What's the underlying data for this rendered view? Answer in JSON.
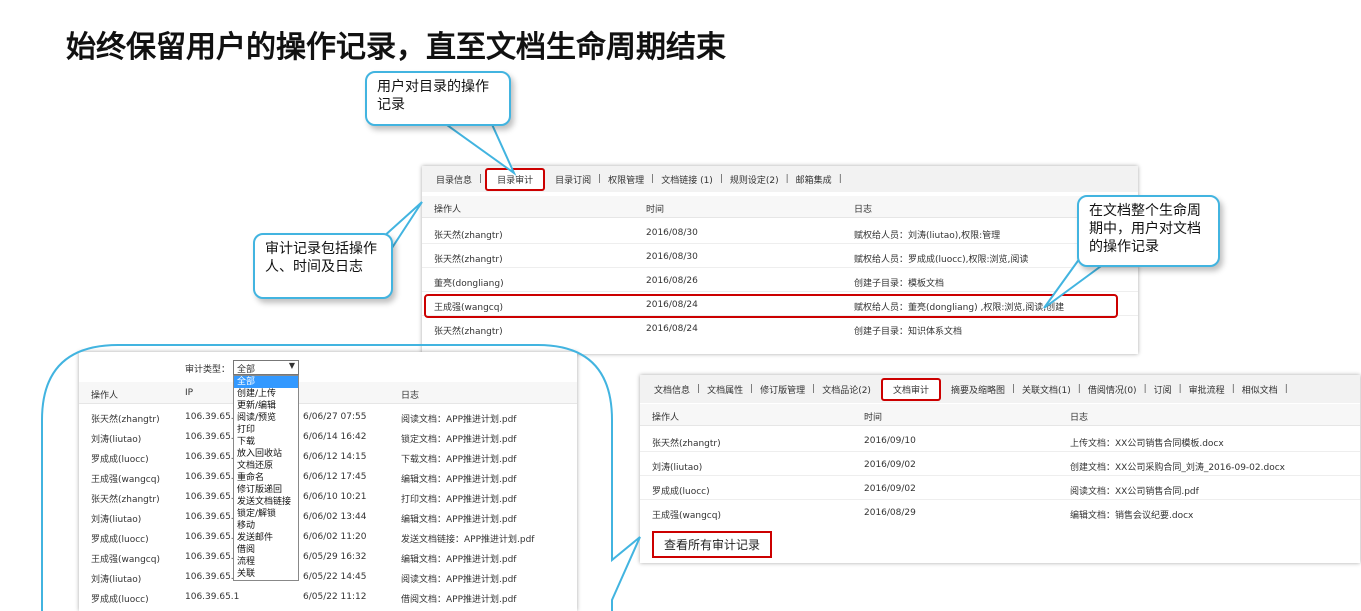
{
  "title": "始终保留用户的操作记录，直至文档生命周期结束",
  "callouts": {
    "dir_ops": "用户对目录的操作记录",
    "audit_fields": "审计记录包括操作人、时间及日志",
    "lifecycle": "在文档整个生命周期中，用户对文档的操作记录"
  },
  "dir_panel": {
    "tabs": [
      {
        "label": "目录信息",
        "active": false
      },
      {
        "label": "目录审计",
        "active": true
      },
      {
        "label": "目录订阅",
        "active": false
      },
      {
        "label": "权限管理",
        "active": false
      },
      {
        "label": "文档链接 (1)",
        "active": false
      },
      {
        "label": "规则设定(2)",
        "active": false
      },
      {
        "label": "邮箱集成",
        "active": false
      }
    ],
    "columns": [
      "操作人",
      "时间",
      "日志"
    ],
    "rows": [
      {
        "user": "张天然(zhangtr)",
        "time": "2016/08/30",
        "log": "赋权给人员：刘涛(liutao),权限:管理"
      },
      {
        "user": "张天然(zhangtr)",
        "time": "2016/08/30",
        "log": "赋权给人员：罗成成(luocc),权限:浏览,阅读"
      },
      {
        "user": "董亮(dongliang)",
        "time": "2016/08/26",
        "log": "创建子目录：模板文档"
      },
      {
        "user": "王成强(wangcq)",
        "time": "2016/08/24",
        "log": "赋权给人员：董亮(dongliang) ,权限:浏览,阅读,创建"
      },
      {
        "user": "张天然(zhangtr)",
        "time": "2016/08/24",
        "log": "创建子目录：知识体系文档"
      }
    ]
  },
  "audit_panel": {
    "filter_label": "审计类型：",
    "filter_value": "全部",
    "options": [
      "全部",
      "创建/上传",
      "更新/编辑",
      "阅读/预览",
      "打印",
      "下载",
      "放入回收站",
      "文档还原",
      "重命名",
      "修订版递回",
      "发送文档链接",
      "锁定/解锁",
      "移动",
      "发送邮件",
      "借阅",
      "流程",
      "关联"
    ],
    "columns": [
      "操作人",
      "IP",
      "日志"
    ],
    "rows": [
      {
        "user": "张天然(zhangtr)",
        "ip": "106.39.65.1",
        "time": "6/06/27 07:55",
        "log": "阅读文档：APP推进计划.pdf"
      },
      {
        "user": "刘涛(liutao)",
        "ip": "106.39.65.1",
        "time": "6/06/14 16:42",
        "log": "锁定文档：APP推进计划.pdf"
      },
      {
        "user": "罗成成(luocc)",
        "ip": "106.39.65.1",
        "time": "6/06/12 14:15",
        "log": "下载文档：APP推进计划.pdf"
      },
      {
        "user": "王成强(wangcq)",
        "ip": "106.39.65.1",
        "time": "6/06/12 17:45",
        "log": "编辑文档：APP推进计划.pdf"
      },
      {
        "user": "张天然(zhangtr)",
        "ip": "106.39.65.1",
        "time": "6/06/10 10:21",
        "log": "打印文档：APP推进计划.pdf"
      },
      {
        "user": "刘涛(liutao)",
        "ip": "106.39.65.1",
        "time": "6/06/02 13:44",
        "log": "编辑文档：APP推进计划.pdf"
      },
      {
        "user": "罗成成(luocc)",
        "ip": "106.39.65.1",
        "time": "6/06/02 11:20",
        "log": "发送文档链接：APP推进计划.pdf"
      },
      {
        "user": "王成强(wangcq)",
        "ip": "106.39.65.1",
        "time": "6/05/29 16:32",
        "log": "编辑文档：APP推进计划.pdf"
      },
      {
        "user": "刘涛(liutao)",
        "ip": "106.39.65.1",
        "time": "6/05/22 14:45",
        "log": "阅读文档：APP推进计划.pdf"
      },
      {
        "user": "罗成成(luocc)",
        "ip": "106.39.65.1",
        "time": "6/05/22 11:12",
        "log": "借阅文档：APP推进计划.pdf"
      }
    ]
  },
  "doc_panel": {
    "tabs": [
      {
        "label": "文档信息",
        "active": false
      },
      {
        "label": "文档属性",
        "active": false
      },
      {
        "label": "修订版管理",
        "active": false
      },
      {
        "label": "文档品论(2)",
        "active": false
      },
      {
        "label": "文档审计",
        "active": true
      },
      {
        "label": "摘要及缩略图",
        "active": false
      },
      {
        "label": "关联文档(1)",
        "active": false
      },
      {
        "label": "借阅情况(0)",
        "active": false
      },
      {
        "label": "订阅",
        "active": false
      },
      {
        "label": "审批流程",
        "active": false
      },
      {
        "label": "相似文档",
        "active": false
      }
    ],
    "columns": [
      "操作人",
      "时间",
      "日志"
    ],
    "rows": [
      {
        "user": "张天然(zhangtr)",
        "time": "2016/09/10",
        "log": "上传文档：XX公司销售合同模板.docx"
      },
      {
        "user": "刘涛(liutao)",
        "time": "2016/09/02",
        "log": "创建文档：XX公司采购合同_刘涛_2016-09-02.docx"
      },
      {
        "user": "罗成成(luocc)",
        "time": "2016/09/02",
        "log": "阅读文档：XX公司销售合同.pdf"
      },
      {
        "user": "王成强(wangcq)",
        "time": "2016/08/29",
        "log": "编辑文档：销售会议纪要.docx"
      }
    ],
    "view_all": "查看所有审计记录"
  },
  "colors": {
    "callout_border": "#42b4e0",
    "highlight": "#cc0000",
    "selected": "#3399ff"
  }
}
